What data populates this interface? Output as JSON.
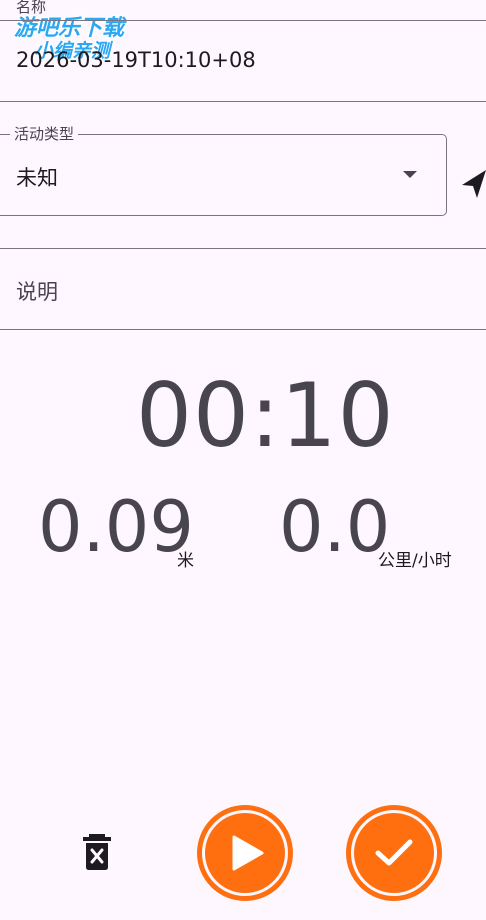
{
  "watermark": {
    "line1": "游吧乐下载",
    "line2": "小编亲测"
  },
  "name_field": {
    "label": "名称",
    "value": "2026-03-19T10:10+08"
  },
  "activity_type": {
    "label": "活动类型",
    "value": "未知",
    "dropdown_icon": "caret-down-icon",
    "location_icon": "navigation-arrow-icon"
  },
  "description_field": {
    "placeholder": "说明"
  },
  "timer": {
    "elapsed": "00:10"
  },
  "distance": {
    "value": "0.09",
    "unit": "米"
  },
  "speed": {
    "value": "0.0",
    "unit": "公里/小时"
  },
  "actions": {
    "delete_icon": "trash-x-icon",
    "play_icon": "play-icon",
    "finish_icon": "check-icon",
    "accent": "#FF6F0F"
  }
}
